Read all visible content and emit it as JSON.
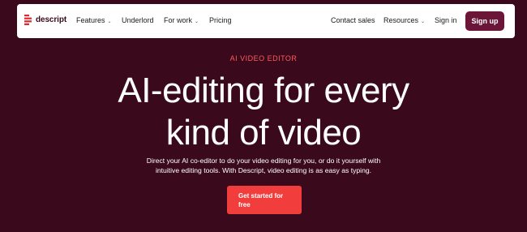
{
  "nav": {
    "brand": "descript",
    "items": [
      "Features",
      "Underlord",
      "For work",
      "Pricing"
    ],
    "right_items": [
      "Contact sales",
      "Resources",
      "Sign in"
    ],
    "signup": "Sign up"
  },
  "hero": {
    "eyebrow": "AI VIDEO EDITOR",
    "headline_line1": "AI-editing for every",
    "headline_line2": "kind of video",
    "sub_line1": "Direct your AI co-editor to do your video editing for you, or do it yourself with",
    "sub_line2": "intuitive editing tools. With Descript, video editing is as easy as typing.",
    "cta_line1": "Get started for",
    "cta_line2": "free"
  },
  "colors": {
    "background": "#3a0a1c",
    "accent": "#f23d3d",
    "signup": "#6b1638"
  }
}
